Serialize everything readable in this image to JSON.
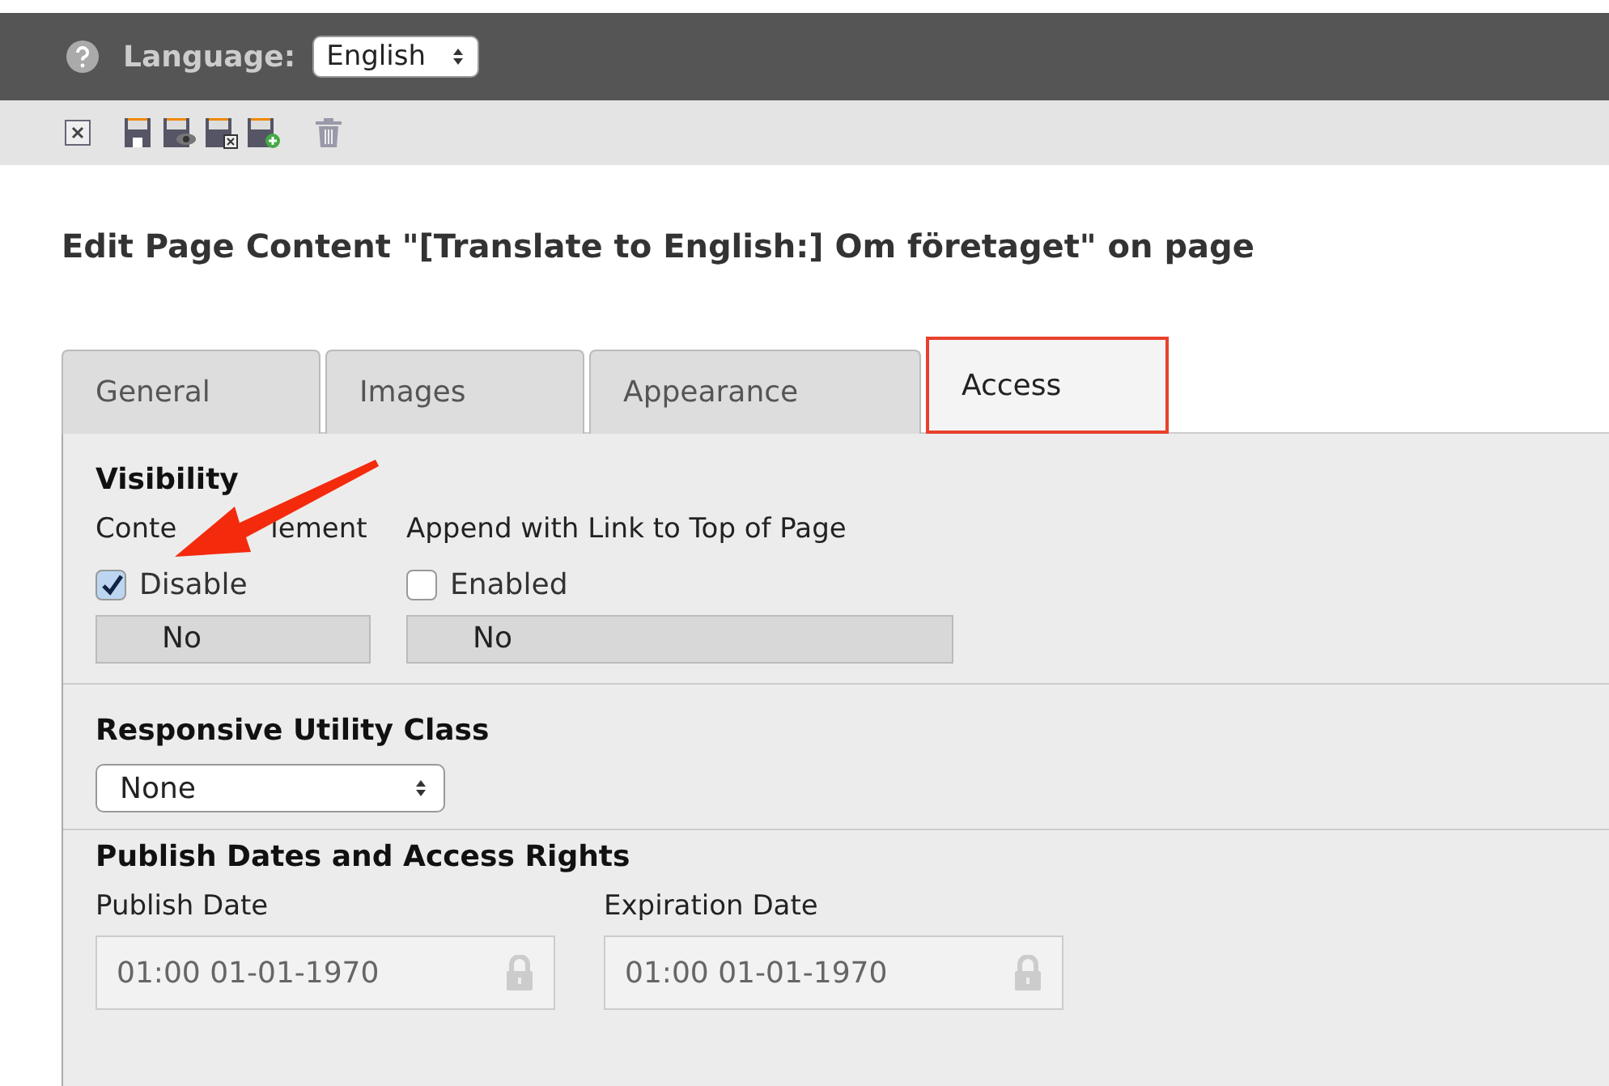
{
  "header": {
    "language_label": "Language:",
    "language": "English"
  },
  "title": "Edit Page Content \"[Translate to English:] Om företaget\" on page",
  "tabs": [
    {
      "label": "General",
      "selected": false
    },
    {
      "label": "Images",
      "selected": false
    },
    {
      "label": "Appearance",
      "selected": false
    },
    {
      "label": "Access",
      "selected": true
    }
  ],
  "visibility": {
    "heading": "Visibility",
    "fields": [
      {
        "label_parts": [
          "Conte",
          "lement"
        ],
        "option": "Disable",
        "checked": true,
        "value": "No"
      },
      {
        "label": "Append with Link to Top of Page",
        "option": "Enabled",
        "checked": false,
        "value": "No"
      }
    ]
  },
  "responsive": {
    "heading": "Responsive Utility Class",
    "value": "None"
  },
  "publish": {
    "heading": "Publish Dates and Access Rights",
    "fields": [
      {
        "label": "Publish Date",
        "value": "01:00 01-01-1970",
        "locked": true
      },
      {
        "label": "Expiration Date",
        "value": "01:00 01-01-1970",
        "locked": true
      }
    ]
  }
}
